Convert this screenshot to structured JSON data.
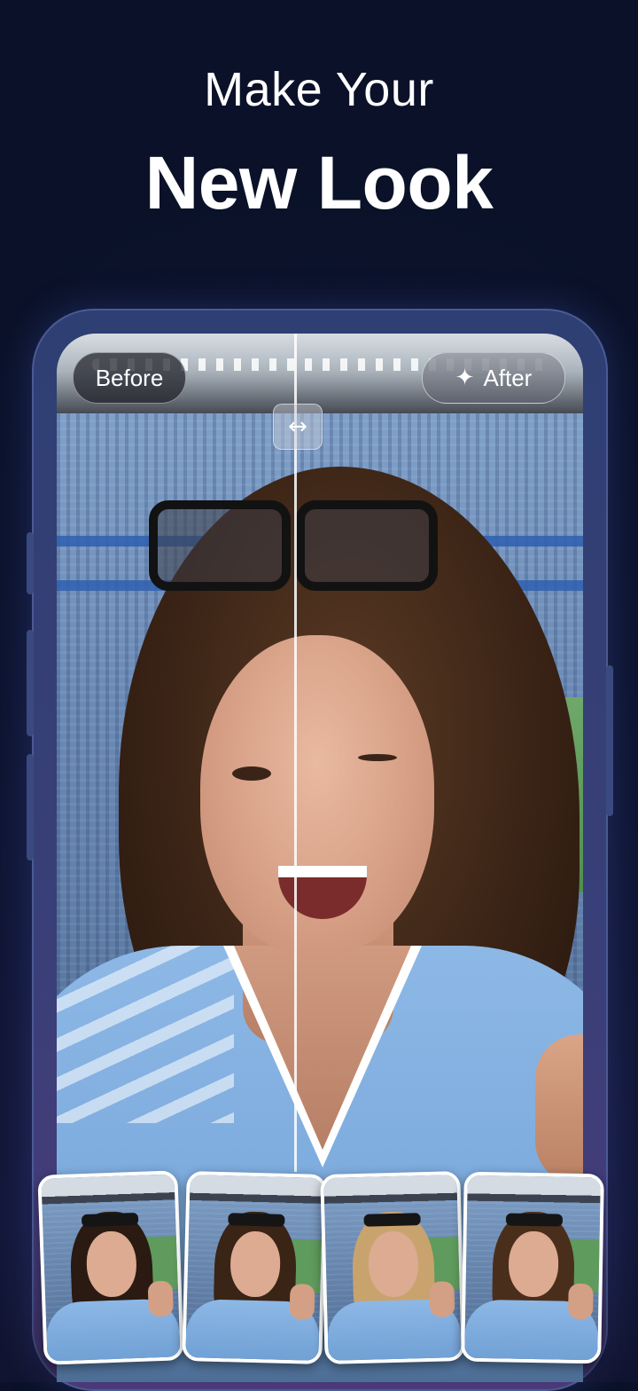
{
  "headline": {
    "line1": "Make Your",
    "line2": "New Look"
  },
  "comparison": {
    "before_label": "Before",
    "after_label": "After",
    "slider_icon": "left-right-arrow-icon",
    "sparkle_icon": "sparkle-icon"
  },
  "style_thumbnails": [
    {
      "hair_color": "#2a1a12",
      "selected": false
    },
    {
      "hair_color": "#3a2416",
      "selected": false
    },
    {
      "hair_color": "#c9a36e",
      "selected": false
    },
    {
      "hair_color": "#4a2e1c",
      "selected": false
    }
  ],
  "colors": {
    "background": "#0d1430",
    "accent_frame": "#3a4a80",
    "text": "#ffffff"
  }
}
